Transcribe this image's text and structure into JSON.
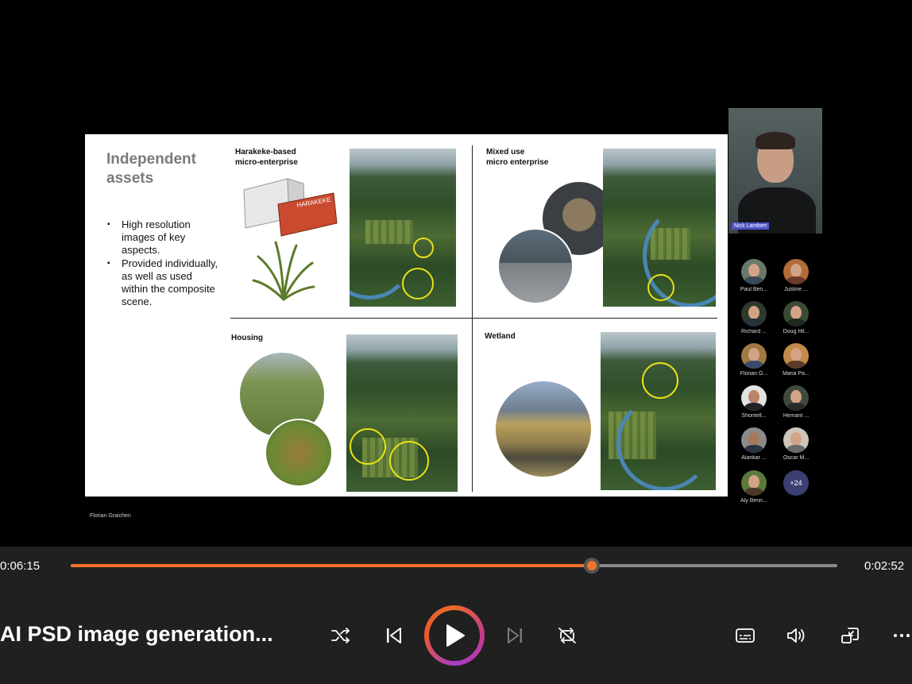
{
  "slide": {
    "title": "Independent assets",
    "bullets": [
      "High resolution images of key aspects.",
      "Provided individually, as well as used within the composite scene."
    ],
    "quadrants": {
      "q1_label": "Harakeke-based\nmicro-enterprise",
      "q2_label": "Mixed use\nmicro enterprise",
      "q3_label": "Housing",
      "q4_label": "Wetland"
    },
    "container_text": "HARAKEKE",
    "footer_name": "Florian Graichen"
  },
  "presenter": {
    "name": "Nick Lambert"
  },
  "participants": [
    {
      "name": "Paul Ben..."
    },
    {
      "name": "Justine ..."
    },
    {
      "name": "Richard ..."
    },
    {
      "name": "Doug Hil..."
    },
    {
      "name": "Florian G..."
    },
    {
      "name": "Maria Pa..."
    },
    {
      "name": "Shontell..."
    },
    {
      "name": "Hemant ..."
    },
    {
      "name": "Alankar ..."
    },
    {
      "name": "Oscar M..."
    },
    {
      "name": "Aly Benn..."
    }
  ],
  "more_participants": "+24",
  "player": {
    "elapsed": "0:06:15",
    "remaining": "0:02:52",
    "progress": 0.68,
    "title": "AI PSD image generation...",
    "accent_color": "#f2722b",
    "icons": [
      "shuffle-icon",
      "previous-icon",
      "play-icon",
      "next-icon",
      "repeat-off-icon",
      "captions-icon",
      "volume-icon",
      "mini-player-icon",
      "more-icon"
    ]
  }
}
